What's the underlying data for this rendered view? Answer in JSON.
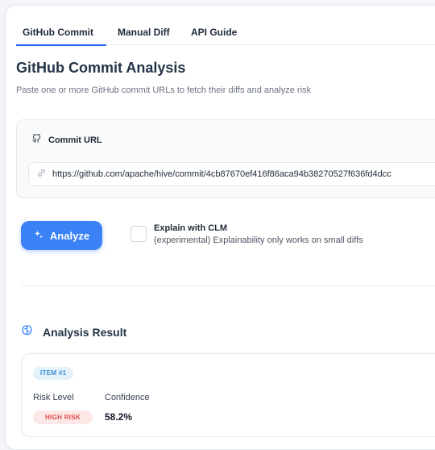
{
  "tabs": [
    {
      "label": "GitHub Commit",
      "active": true
    },
    {
      "label": "Manual Diff",
      "active": false
    },
    {
      "label": "API Guide",
      "active": false
    }
  ],
  "page": {
    "title": "GitHub Commit Analysis",
    "subtitle": "Paste one or more GitHub commit URLs to fetch their diffs and analyze risk"
  },
  "commit_url": {
    "label": "Commit URL",
    "value": "https://github.com/apache/hive/commit/4cb87670ef416f86aca94b38270527f636fd4dcc"
  },
  "actions": {
    "analyze_label": "Analyze",
    "explain_title": "Explain with CLM",
    "explain_desc": "(experimental) Explainability only works on small diffs",
    "explain_checked": false
  },
  "result": {
    "heading": "Analysis Result",
    "item_badge": "ITEM #1",
    "risk_label": "Risk Level",
    "confidence_label": "Confidence",
    "risk_value": "HIGH RISK",
    "confidence_value": "58.2%"
  },
  "colors": {
    "accent": "#3b82f6",
    "risk_high_bg": "#fde8e8",
    "risk_high_text": "#e24b4b",
    "item_badge_bg": "#e3f1fb"
  },
  "icons": {
    "commit_url": "github-icon",
    "input": "link-icon",
    "analyze": "sparkle-icon",
    "result": "brain-icon"
  }
}
